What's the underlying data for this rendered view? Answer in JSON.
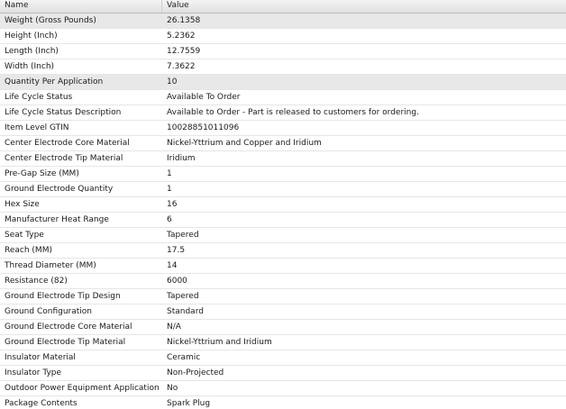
{
  "table": {
    "columns": [
      "Name",
      "Value"
    ],
    "rows": [
      {
        "name": "Weight (Gross Pounds)",
        "value": "26.1358",
        "selected": true
      },
      {
        "name": "Height (Inch)",
        "value": "5.2362",
        "selected": false
      },
      {
        "name": "Length (Inch)",
        "value": "12.7559",
        "selected": false
      },
      {
        "name": "Width (Inch)",
        "value": "7.3622",
        "selected": false
      },
      {
        "name": "Quantity Per Application",
        "value": "10",
        "selected": true
      },
      {
        "name": "Life Cycle Status",
        "value": "Available To Order",
        "selected": false
      },
      {
        "name": "Life Cycle Status Description",
        "value": "Available to Order - Part is released to customers for ordering.",
        "selected": false
      },
      {
        "name": "Item Level GTIN",
        "value": "10028851011096",
        "selected": false
      },
      {
        "name": "Center Electrode Core Material",
        "value": "Nickel-Yttrium and Copper and Iridium",
        "selected": false
      },
      {
        "name": "Center Electrode Tip Material",
        "value": "Iridium",
        "selected": false
      },
      {
        "name": "Pre-Gap Size (MM)",
        "value": "1",
        "selected": false
      },
      {
        "name": "Ground Electrode Quantity",
        "value": "1",
        "selected": false
      },
      {
        "name": "Hex Size",
        "value": "16",
        "selected": false
      },
      {
        "name": "Manufacturer Heat Range",
        "value": "6",
        "selected": false
      },
      {
        "name": "Seat Type",
        "value": "Tapered",
        "selected": false
      },
      {
        "name": "Reach (MM)",
        "value": "17.5",
        "selected": false
      },
      {
        "name": "Thread Diameter (MM)",
        "value": "14",
        "selected": false
      },
      {
        "name": "Resistance (82)",
        "value": "6000",
        "selected": false
      },
      {
        "name": "Ground Electrode Tip Design",
        "value": "Tapered",
        "selected": false
      },
      {
        "name": "Ground Configuration",
        "value": "Standard",
        "selected": false
      },
      {
        "name": "Ground Electrode Core Material",
        "value": "N/A",
        "selected": false
      },
      {
        "name": "Ground Electrode Tip Material",
        "value": "Nickel-Yttrium and Iridium",
        "selected": false
      },
      {
        "name": "Insulator Material",
        "value": "Ceramic",
        "selected": false
      },
      {
        "name": "Insulator Type",
        "value": "Non-Projected",
        "selected": false
      },
      {
        "name": "Outdoor Power Equipment Application",
        "value": "No",
        "selected": false
      },
      {
        "name": "Package Contents",
        "value": "Spark Plug",
        "selected": false
      }
    ]
  }
}
